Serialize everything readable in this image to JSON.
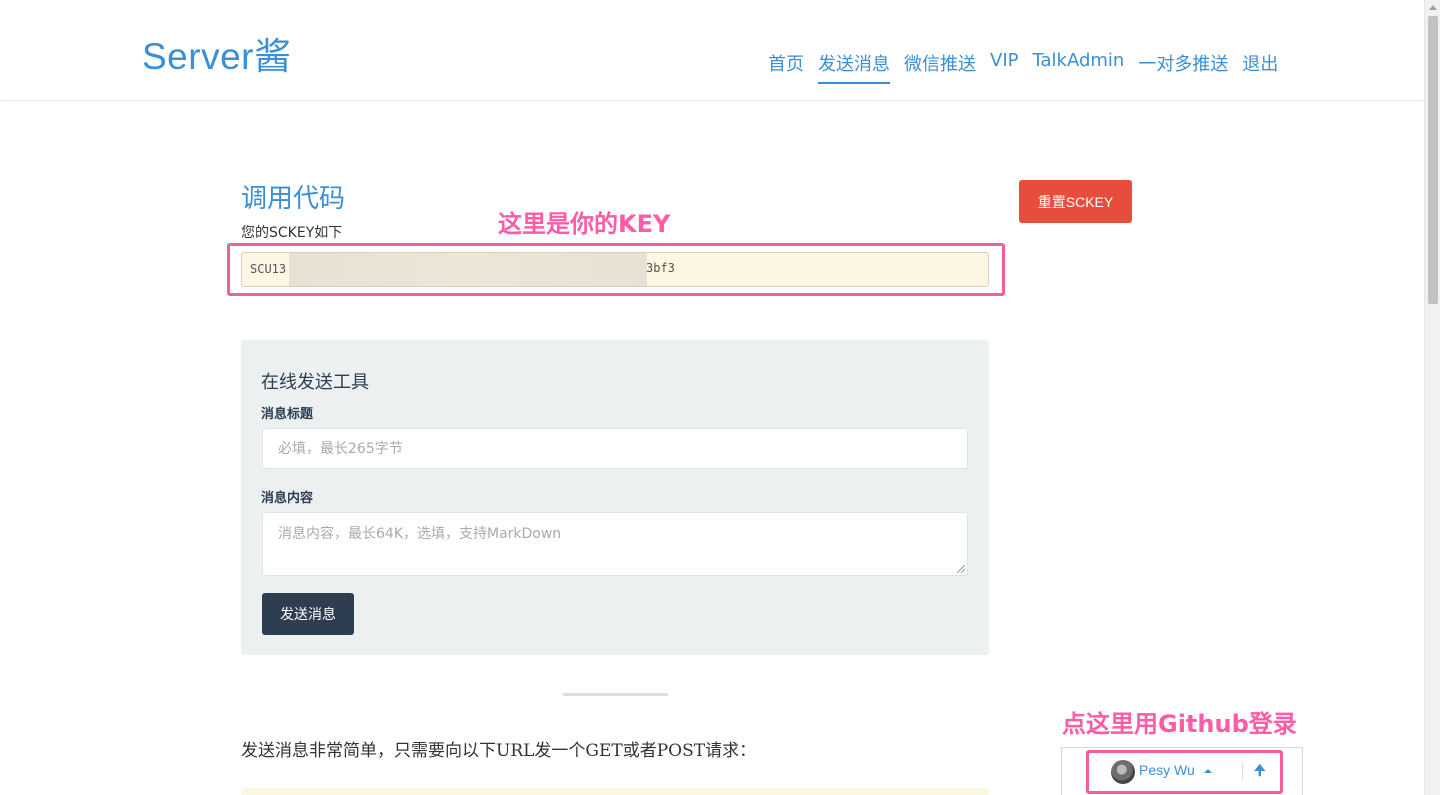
{
  "header": {
    "brand": "Server酱",
    "nav": [
      "首页",
      "发送消息",
      "微信推送",
      "VIP",
      "TalkAdmin",
      "一对多推送",
      "退出"
    ],
    "active_nav": "发送消息"
  },
  "key_section": {
    "title": "调用代码",
    "label": "您的SCKEY如下",
    "key_prefix": "SCU13",
    "key_suffix": "3bf3",
    "annotation": "这里是你的KEY",
    "reset_button": "重置SCKEY"
  },
  "send_tool": {
    "title": "在线发送工具",
    "title_label": "消息标题",
    "title_placeholder": "必填，最长265字节",
    "content_label": "消息内容",
    "content_placeholder": "消息内容，最长64K，选填，支持MarkDown",
    "send_button": "发送消息"
  },
  "intro": {
    "text": "发送消息非常简单，只需要向以下URL发一个GET或者POST请求："
  },
  "github_login": {
    "annotation": "点这里用Github登录",
    "username": "Pesy Wu",
    "up_symbol": "🠉"
  },
  "colors": {
    "brand": "#3a8fd6",
    "danger": "#e74c3c",
    "dark_button": "#2c3e50",
    "annotation": "#ff5ca7"
  },
  "icons": [
    "caret-up-icon",
    "arrow-up-icon",
    "avatar"
  ]
}
